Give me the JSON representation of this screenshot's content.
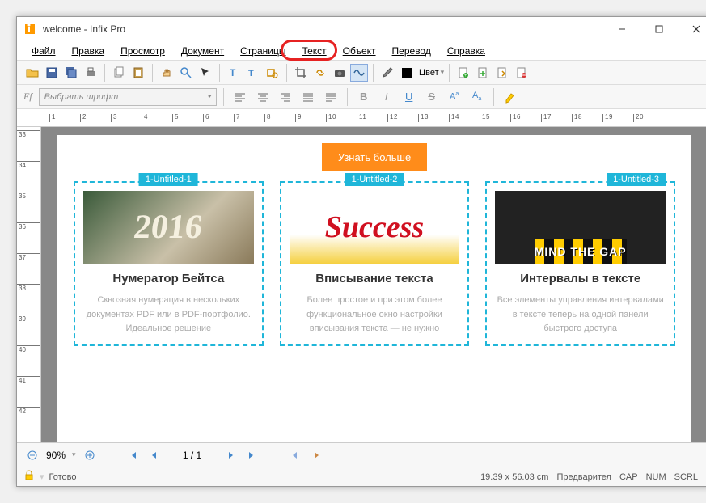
{
  "titlebar": {
    "title": "welcome - Infix Pro"
  },
  "menu": {
    "file": "Файл",
    "edit": "Правка",
    "view": "Просмотр",
    "document": "Документ",
    "pages": "Страницы",
    "text": "Текст",
    "object": "Объект",
    "translate": "Перевод",
    "help": "Справка"
  },
  "toolbar": {
    "color_label": "Цвет"
  },
  "formatbar": {
    "font_placeholder": "Выбрать шрифт"
  },
  "page": {
    "orange_button": "Узнать больше",
    "cols": [
      {
        "label": "1-Untitled-1",
        "img_text": "2016",
        "title": "Нумератор Бейтса",
        "desc": "Сквозная нумерация в нескольких документах PDF или в PDF-портфолио. Идеальное решение"
      },
      {
        "label": "1-Untitled-2",
        "img_text": "Success",
        "title": "Вписывание текста",
        "desc": "Более простое и при этом более функциональное окно настройки вписывания текста — не нужно"
      },
      {
        "label": "1-Untitled-3",
        "img_text": "MIND THE GAP",
        "title": "Интервалы в тексте",
        "desc": "Все элементы управления интервалами в тексте теперь на одной панели быстрого доступа"
      }
    ]
  },
  "nav": {
    "zoom": "90%",
    "page": "1 / 1"
  },
  "status": {
    "ready": "Готово",
    "coords": "19.39 x 56.03 cm",
    "preview": "Предварител",
    "cap": "CAP",
    "num": "NUM",
    "scrl": "SCRL"
  }
}
